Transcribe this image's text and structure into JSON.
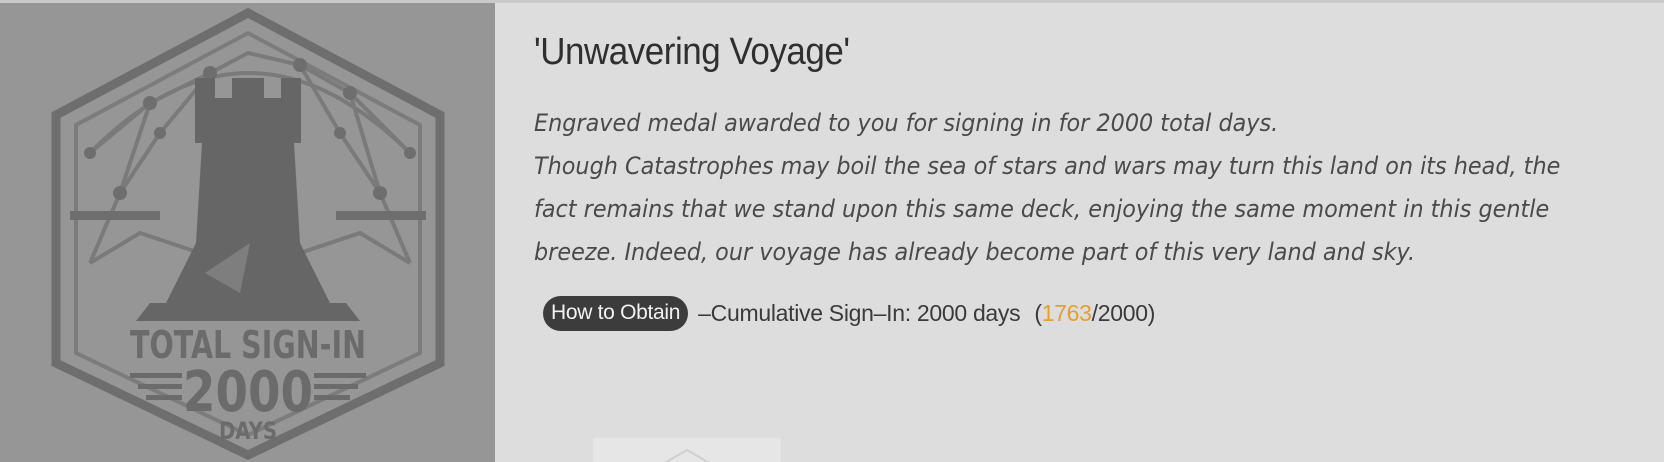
{
  "medal": {
    "icon": "rook-tower-medal-icon",
    "line1": "TOTAL SIGN-IN",
    "line2": "2000",
    "line3": "DAYS"
  },
  "title": "'Unwavering Voyage'",
  "description": {
    "line1": "Engraved medal awarded to you for signing in for 2000 total days.",
    "line2": "Though Catastrophes may boil the sea of stars and wars may turn this land on its head, the",
    "line3": "fact remains that we stand upon this same deck, enjoying the same moment in this gentle",
    "line4": "breeze. Indeed, our voyage has already become part of this very land and sky."
  },
  "obtain": {
    "badge_label": "How to Obtain",
    "prefix": "–Cumulative Sign–In: 2000 days",
    "open_paren": "(",
    "current": "1763",
    "separator_total": "/2000)",
    "progress": 0.8815
  },
  "colors": {
    "accent": "#e5a02a",
    "medal_panel": "#969696",
    "background": "#dddddd"
  }
}
